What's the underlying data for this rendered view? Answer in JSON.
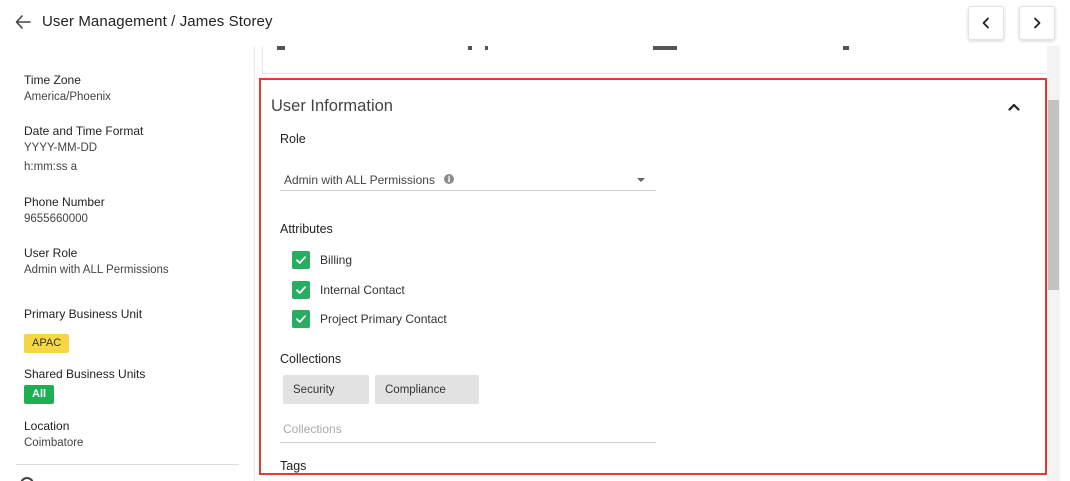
{
  "header": {
    "title": "User Management / James Storey"
  },
  "profile": {
    "time_zone": {
      "label": "Time Zone",
      "value": "America/Phoenix"
    },
    "date_time_format": {
      "label": "Date and Time Format",
      "date": "YYYY-MM-DD",
      "time": "h:mm:ss a"
    },
    "phone": {
      "label": "Phone Number",
      "value": "9655660000"
    },
    "user_role": {
      "label": "User Role",
      "value": "Admin with ALL Permissions"
    },
    "primary_bu": {
      "label": "Primary Business Unit",
      "value": "APAC"
    },
    "shared_bu": {
      "label": "Shared Business Units",
      "value": "All"
    },
    "location": {
      "label": "Location",
      "value": "Coimbatore"
    }
  },
  "user_info": {
    "title": "User Information",
    "role_label": "Role",
    "role_value": "Admin with ALL Permissions",
    "attributes_label": "Attributes",
    "attributes": [
      {
        "label": "Billing",
        "checked": true
      },
      {
        "label": "Internal Contact",
        "checked": true
      },
      {
        "label": "Project Primary Contact",
        "checked": true
      }
    ],
    "collections_label": "Collections",
    "collections": [
      "Security",
      "Compliance"
    ],
    "collections_placeholder": "Collections",
    "tags_label": "Tags"
  },
  "colors": {
    "highlight": "#e53935",
    "checkbox": "#27ae60",
    "badge_yellow": "#f6d642",
    "badge_green": "#1db053"
  },
  "icons": {
    "back": "arrow-left-icon",
    "prev": "chevron-left-icon",
    "next": "chevron-right-icon",
    "collapse": "chevron-up-icon",
    "info": "info-icon",
    "check": "check-icon"
  }
}
